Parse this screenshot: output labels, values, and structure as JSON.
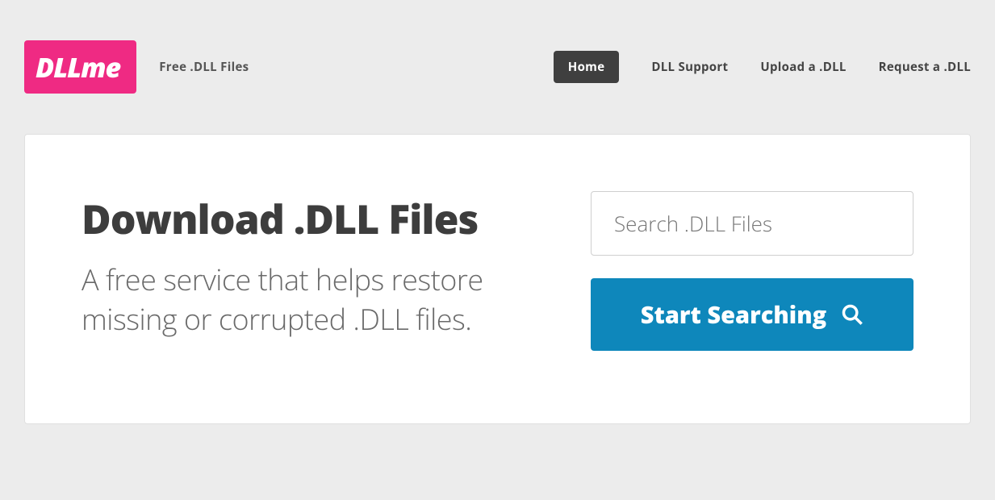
{
  "header": {
    "logo_text": "DLLme",
    "tagline": "Free .DLL Files",
    "nav": [
      {
        "label": "Home",
        "active": true
      },
      {
        "label": "DLL Support",
        "active": false
      },
      {
        "label": "Upload a .DLL",
        "active": false
      },
      {
        "label": "Request a .DLL",
        "active": false
      }
    ]
  },
  "hero": {
    "title": "Download .DLL Files",
    "subtitle": "A free service that helps restore missing or corrupted .DLL files.",
    "search_placeholder": "Search .DLL Files",
    "search_button": "Start Searching"
  }
}
